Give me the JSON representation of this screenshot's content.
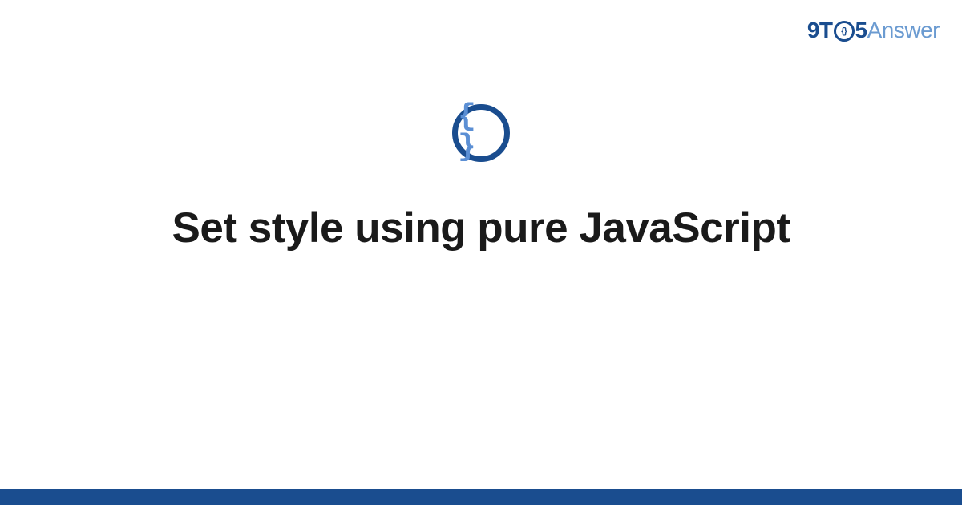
{
  "logo": {
    "part1": "9T",
    "o_inner": "{}",
    "part2": "5",
    "part3": "Answer"
  },
  "icon": {
    "symbol": "{ }"
  },
  "title": "Set style using pure JavaScript",
  "colors": {
    "primary": "#1a4d8f",
    "secondary": "#6b9bd1",
    "brace": "#5b8fd4",
    "text": "#1a1a1a"
  }
}
